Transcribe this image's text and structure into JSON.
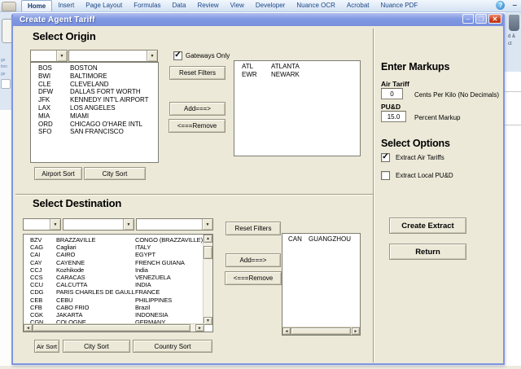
{
  "ribbon": {
    "tabs": [
      "Home",
      "Insert",
      "Page Layout",
      "Formulas",
      "Data",
      "Review",
      "View",
      "Developer",
      "Nuance OCR",
      "Acrobat",
      "Nuance PDF"
    ],
    "active_tab": "Home",
    "icons": {
      "help": "?",
      "window_minimize": "–"
    },
    "left_fragments": [
      "ge",
      "tion",
      "ge"
    ],
    "right_fragments": [
      "d &",
      "ct"
    ]
  },
  "dialog": {
    "title": "Create Agent Tariff",
    "window_icons": {
      "minimize": "–",
      "maximize": "❐",
      "close": "✕"
    },
    "origin": {
      "heading": "Select Origin",
      "gateways_only_label": "Gateways Only",
      "gateways_only_checked": true,
      "check_glyph": "✓",
      "dropdown_arrow": "▼",
      "reset_button": "Reset Filters",
      "add_button": "Add===>",
      "remove_button": "<===Remove",
      "airport_sort_button": "Airport Sort",
      "city_sort_button": "City Sort",
      "airports": [
        {
          "code": "BOS",
          "city": "BOSTON"
        },
        {
          "code": "BWI",
          "city": "BALTIMORE"
        },
        {
          "code": "CLE",
          "city": "CLEVELAND"
        },
        {
          "code": "DFW",
          "city": "DALLAS FORT WORTH"
        },
        {
          "code": "JFK",
          "city": "KENNEDY INT'L AIRPORT"
        },
        {
          "code": "LAX",
          "city": "LOS ANGELES"
        },
        {
          "code": "MIA",
          "city": "MIAMI"
        },
        {
          "code": "ORD",
          "city": "CHICAGO O'HARE INTL"
        },
        {
          "code": "SFO",
          "city": "SAN FRANCISCO"
        }
      ],
      "selected": [
        {
          "code": "ATL",
          "city": "ATLANTA"
        },
        {
          "code": "EWR",
          "city": "NEWARK"
        }
      ]
    },
    "markups": {
      "heading": "Enter Markups",
      "air_tariff_label": "Air Tariff",
      "air_tariff_value": "0",
      "air_tariff_hint": "Cents Per Kilo (No Decimals)",
      "pud_label": "PU&D",
      "pud_value": "15.0",
      "pud_hint": "Percent Markup"
    },
    "options": {
      "heading": "Select Options",
      "extract_air_label": "Extract Air Tariffs",
      "extract_air_checked": true,
      "extract_local_label": "Extract Local PU&D",
      "extract_local_checked": false,
      "check_glyph": "✓"
    },
    "actions": {
      "create_extract_button": "Create Extract",
      "return_button": "Return"
    },
    "destination": {
      "heading": "Select Destination",
      "dropdown_arrow": "▼",
      "reset_button": "Reset Filters",
      "add_button": "Add===>",
      "remove_button": "<===Remove",
      "air_sort_button": "Air Sort",
      "city_sort_button": "City Sort",
      "country_sort_button": "Country Sort",
      "scroll_glyphs": {
        "up": "▲",
        "down": "▼",
        "left": "◄",
        "right": "►"
      },
      "airports": [
        {
          "code": "BZV",
          "city": "BRAZZAVILLE",
          "country": "CONGO (BRAZZAVILLE)"
        },
        {
          "code": "CAG",
          "city": "Cagliari",
          "country": "ITALY"
        },
        {
          "code": "CAI",
          "city": "CAIRO",
          "country": "EGYPT"
        },
        {
          "code": "CAY",
          "city": "CAYENNE",
          "country": "FRENCH GUIANA"
        },
        {
          "code": "CCJ",
          "city": "Kozhikode",
          "country": "India"
        },
        {
          "code": "CCS",
          "city": "CARACAS",
          "country": "VENEZUELA"
        },
        {
          "code": "CCU",
          "city": "CALCUTTA",
          "country": "INDIA"
        },
        {
          "code": "CDG",
          "city": "PARIS CHARLES DE GAULLI",
          "country": "FRANCE"
        },
        {
          "code": "CEB",
          "city": "CEBU",
          "country": "PHILIPPINES"
        },
        {
          "code": "CFB",
          "city": "CABO FRIO",
          "country": "Brazil"
        },
        {
          "code": "CGK",
          "city": "JAKARTA",
          "country": "INDONESIA"
        },
        {
          "code": "CGN",
          "city": "COLOGNE",
          "country": "GERMANY"
        }
      ],
      "selected": [
        {
          "code": "CAN",
          "city": "GUANGZHOU"
        }
      ]
    }
  }
}
